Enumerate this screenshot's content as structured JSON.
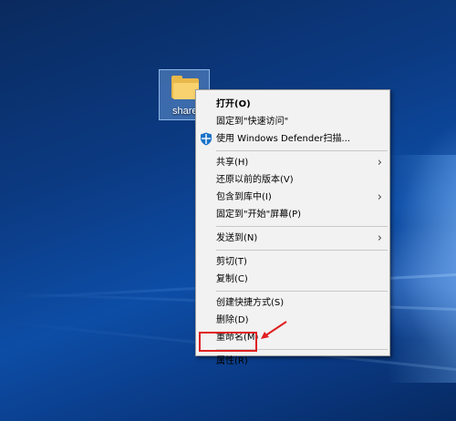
{
  "desktop": {
    "icon_label": "share",
    "icon_name": "folder-icon"
  },
  "context_menu": {
    "items": [
      {
        "label": "打开(O)",
        "bold": true
      },
      {
        "label": "固定到\"快速访问\""
      },
      {
        "label": "使用 Windows Defender扫描...",
        "icon": "windows-defender-shield-icon"
      },
      {
        "label": "共享(H)",
        "submenu": true
      },
      {
        "label": "还原以前的版本(V)"
      },
      {
        "label": "包含到库中(I)",
        "submenu": true
      },
      {
        "label": "固定到\"开始\"屏幕(P)"
      },
      {
        "label": "发送到(N)",
        "submenu": true
      },
      {
        "label": "剪切(T)"
      },
      {
        "label": "复制(C)"
      },
      {
        "label": "创建快捷方式(S)"
      },
      {
        "label": "删除(D)"
      },
      {
        "label": "重命名(M)"
      },
      {
        "label": "属性(R)",
        "highlighted": true
      }
    ],
    "submenu_glyph": "›"
  },
  "colors": {
    "menu_background": "#f2f2f2",
    "highlight_border": "#e02020",
    "arrow": "#e02020",
    "shield_blue": "#1a73c8"
  }
}
